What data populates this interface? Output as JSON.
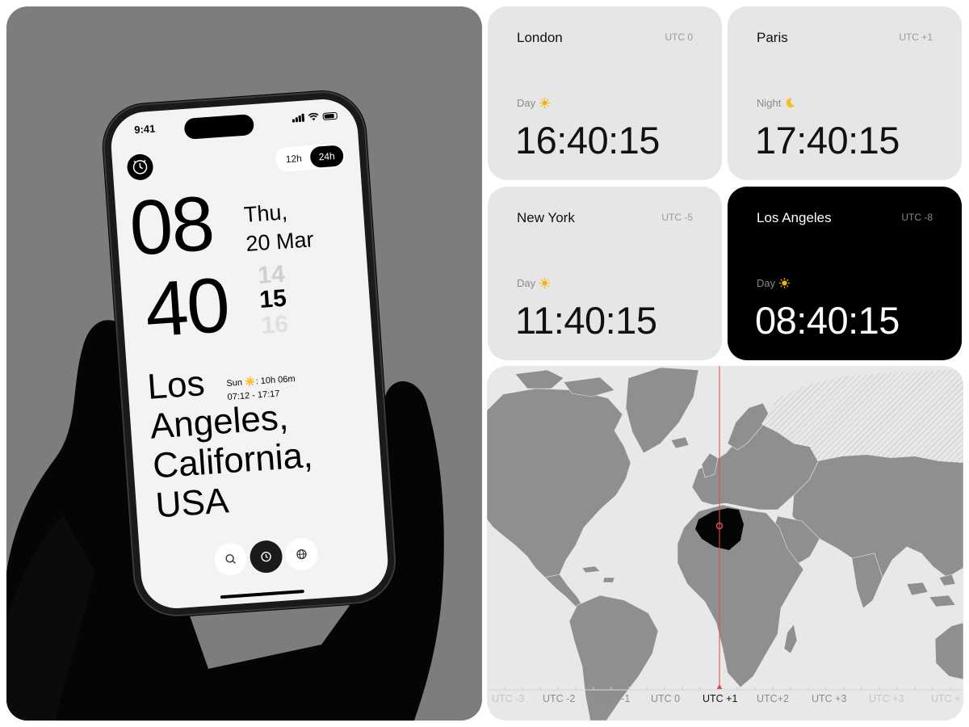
{
  "phone": {
    "status_time": "9:41",
    "format_toggle": {
      "option_12h": "12h",
      "option_24h": "24h",
      "selected": "24h"
    },
    "hours": "08",
    "minutes": "40",
    "day": "Thu,",
    "date": "20 Mar",
    "seconds_prev": "14",
    "seconds": "15",
    "seconds_next": "16",
    "city": "Los\nAngeles,\nCalifornia,\nUSA",
    "sun_line": "Sun ☀️: 10h 06m",
    "sun_times": "07:12 - 17:17",
    "nav": [
      "search-icon",
      "clock-icon",
      "globe-icon"
    ]
  },
  "cards": [
    {
      "city": "London",
      "utc": "UTC 0",
      "period": "Day",
      "period_icon": "sun-icon",
      "time": "16:40:15",
      "dark": false
    },
    {
      "city": "Paris",
      "utc": "UTC +1",
      "period": "Night",
      "period_icon": "moon-icon",
      "time": "17:40:15",
      "dark": false
    },
    {
      "city": "New York",
      "utc": "UTC -5",
      "period": "Day",
      "period_icon": "sun-icon",
      "time": "11:40:15",
      "dark": false
    },
    {
      "city": "Los Angeles",
      "utc": "UTC -8",
      "period": "Day",
      "period_icon": "sun-icon",
      "time": "08:40:15",
      "dark": true
    }
  ],
  "map": {
    "highlighted_country": "Algeria",
    "timezone_labels": [
      "UTC -3",
      "UTC -2",
      "UTC -1",
      "UTC 0",
      "UTC +1",
      "UTC+2",
      "UTC +3",
      "UTC +3",
      "UTC +"
    ],
    "selected_zone": "UTC +1",
    "marker_color": "#e04a4a"
  },
  "colors": {
    "accent": "#000000",
    "card_bg": "#e6e6e6",
    "map_land": "#8f8f8f",
    "map_bg": "#e8e8e8"
  }
}
